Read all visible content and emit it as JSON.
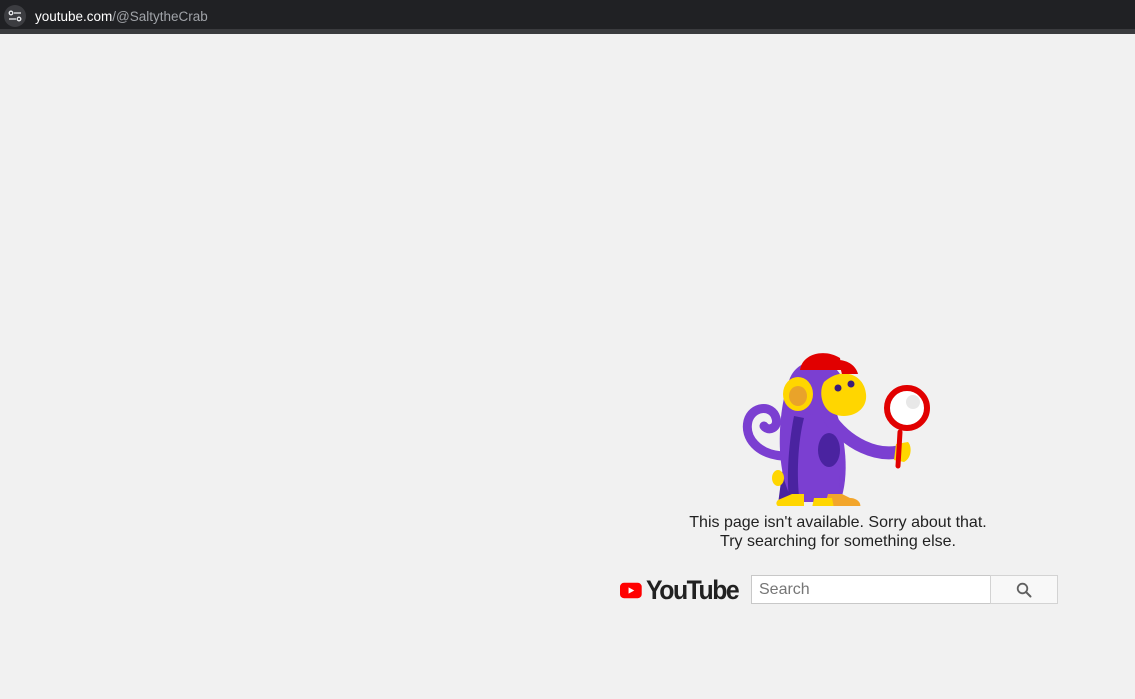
{
  "browser": {
    "url_domain": "youtube.com",
    "url_path": "/@SaltytheCrab"
  },
  "error": {
    "line1": "This page isn't available. Sorry about that.",
    "line2": "Try searching for something else."
  },
  "logo": {
    "text": "YouTube"
  },
  "search": {
    "placeholder": "Search"
  },
  "colors": {
    "brand_red": "#ff0000",
    "page_bg": "#f1f1f1",
    "browser_bar": "#202124"
  }
}
